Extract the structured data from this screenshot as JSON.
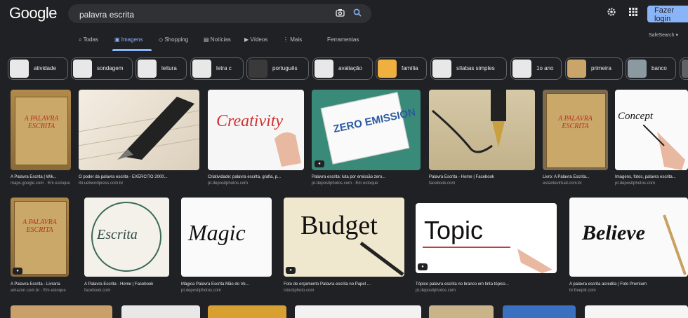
{
  "header": {
    "logo": "Google",
    "query": "palavra escrita",
    "login_label": "Fazer login",
    "safesearch": "SafeSearch"
  },
  "icons": {
    "camera": "camera-icon",
    "search": "search-icon",
    "settings": "gear-icon",
    "apps": "apps-grid-icon"
  },
  "tabs": [
    {
      "label": "Todas"
    },
    {
      "label": "Imagens"
    },
    {
      "label": "Shopping"
    },
    {
      "label": "Notícias"
    },
    {
      "label": "Vídeos"
    },
    {
      "label": "Mais"
    },
    {
      "label": "Ferramentas"
    }
  ],
  "chips": [
    {
      "label": "atividade"
    },
    {
      "label": "sondagem"
    },
    {
      "label": "leitura"
    },
    {
      "label": "letra c"
    },
    {
      "label": "português"
    },
    {
      "label": "avaliação"
    },
    {
      "label": "família"
    },
    {
      "label": "sílabas simples"
    },
    {
      "label": "1o ano"
    },
    {
      "label": "primeira"
    },
    {
      "label": "banco"
    }
  ],
  "row1": [
    {
      "caption": "A Palavra Escrita | Wik...",
      "source": "maps.google.com · Em estoque",
      "book_title": "A PALAVRA ESCRITA"
    },
    {
      "caption": "O poder da palavra escrita - EXÉRCITO 2000...",
      "source": "ibi.uelwordpress.com.br"
    },
    {
      "caption": "Criatividade: palavra escrita, grafia, p...",
      "source": "pt.depositphotos.com",
      "word": "Creativity"
    },
    {
      "caption": "Palavra escrita: luta por emissão zero...",
      "source": "pt.depositphotos.com · Em estoque",
      "word": "ZERO EMISSION"
    },
    {
      "caption": "Palavra Escrita - Home | Facebook",
      "source": "facebook.com"
    },
    {
      "caption": "Livro: A Palavra Escrita...",
      "source": "estantevirtual.com.br",
      "book_title": "A PALAVRA ESCRITA"
    },
    {
      "caption": "Imagens, fotos, palavra escrita...",
      "source": "pt.depositphotos.com",
      "word": "Concept"
    }
  ],
  "row2": [
    {
      "caption": "A Palavra Escrita - Livraria",
      "source": "amazon.com.br · Em estoque",
      "book_title": "A PALAVRA ESCRITA"
    },
    {
      "caption": "A Palavra Escrita - Home | Facebook",
      "source": "facebook.com",
      "word": "Escrita"
    },
    {
      "caption": "Mágica Palavra Escrita Mão do Ve...",
      "source": "pt.depositphotos.com",
      "word": "Magic"
    },
    {
      "caption": "Foto de orçamento Palavra escrita no Papel ...",
      "source": "istockphoto.com",
      "word": "Budget"
    },
    {
      "caption": "Tópico palavra escrita no branco em tinta tópico...",
      "source": "pt.depositphotos.com",
      "word": "Topic"
    },
    {
      "caption": "A palavra escrita acredita | Foto Premium",
      "source": "br.freepik.com",
      "word": "Believe"
    }
  ]
}
